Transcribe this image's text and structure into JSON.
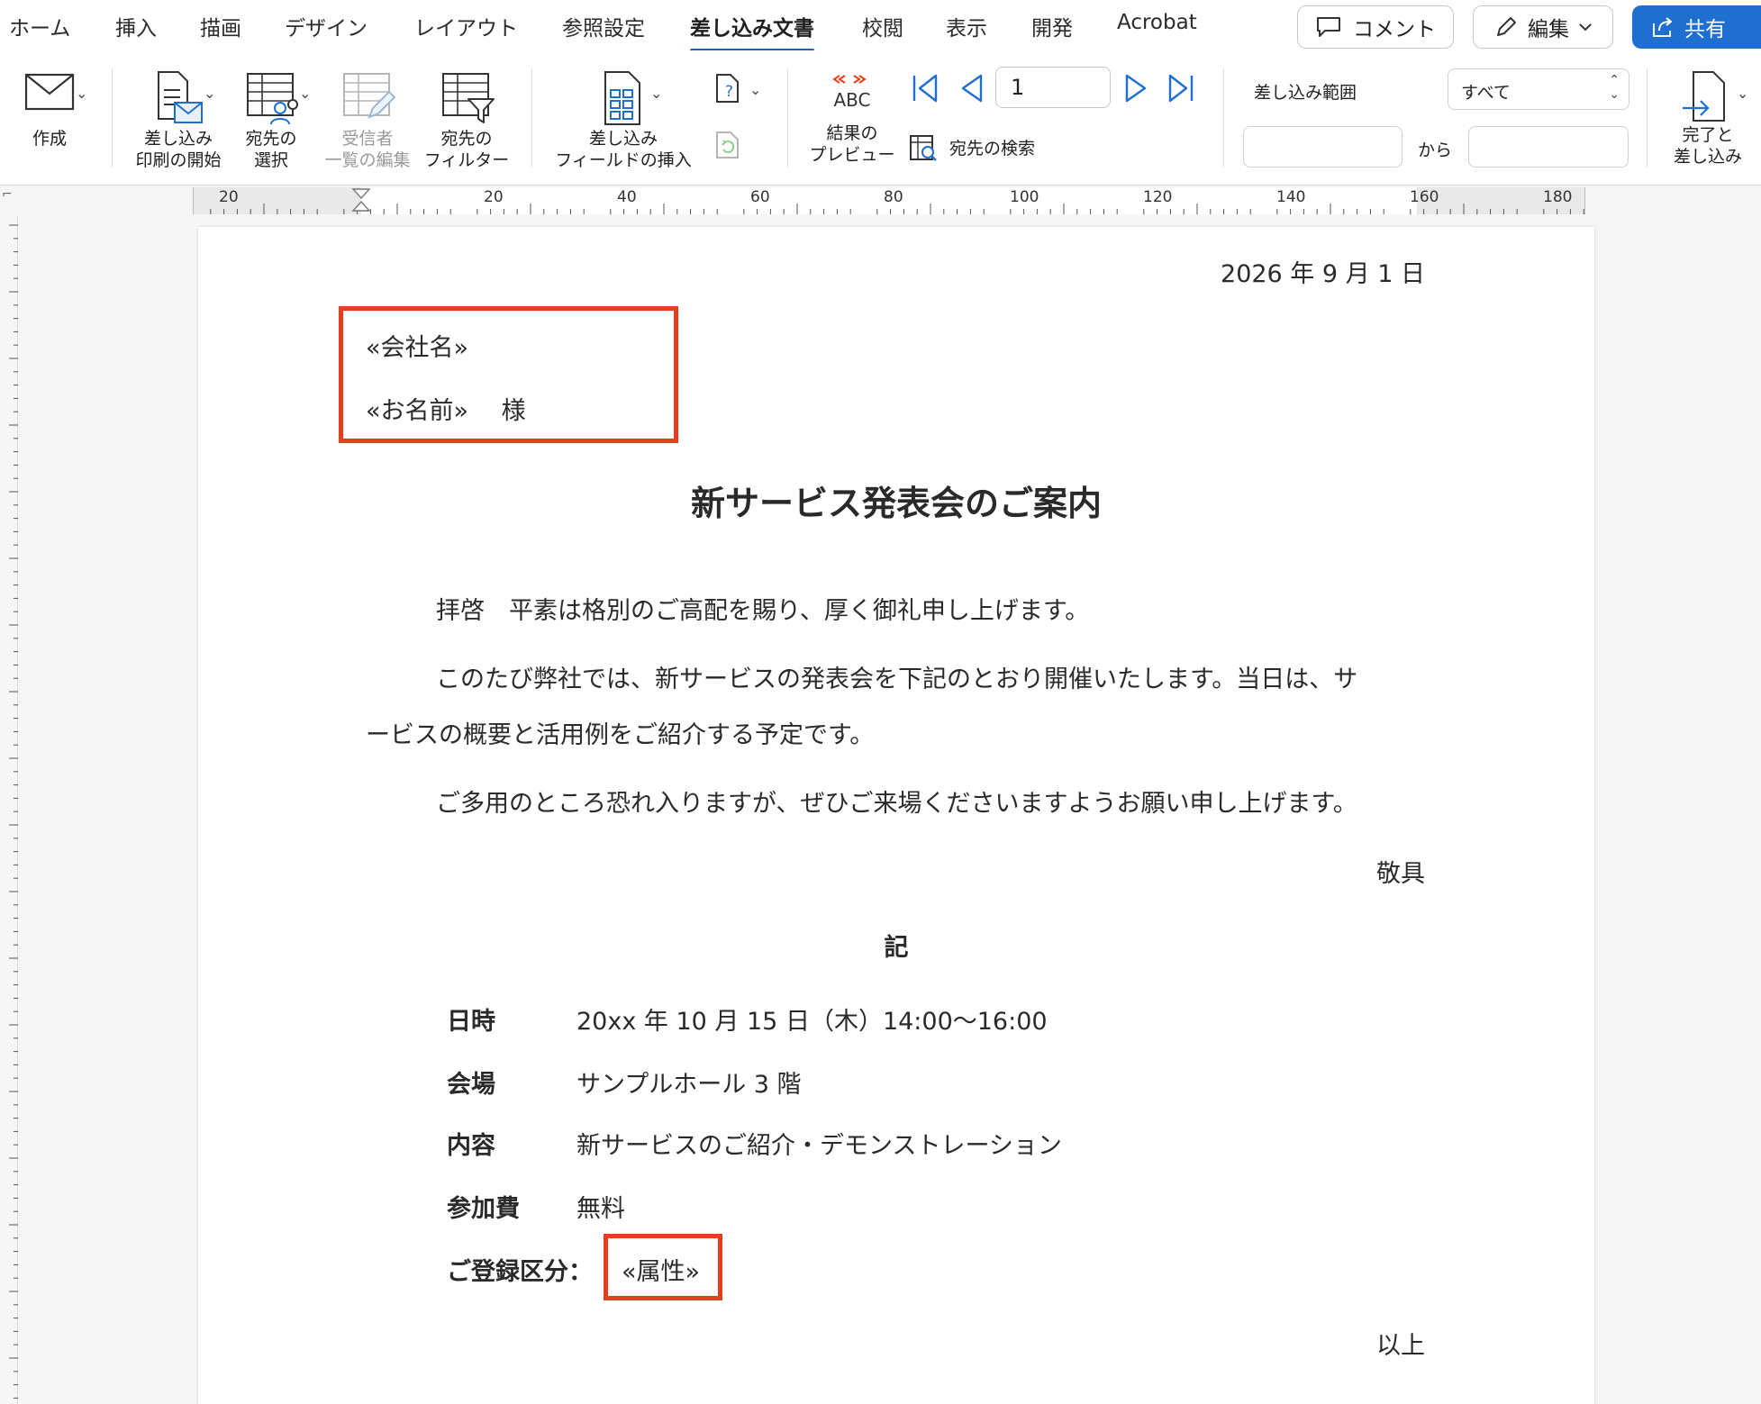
{
  "menu": {
    "tabs": [
      "ホーム",
      "挿入",
      "描画",
      "デザイン",
      "レイアウト",
      "参照設定",
      "差し込み文書",
      "校閲",
      "表示",
      "開発",
      "Acrobat"
    ],
    "active_tab": "差し込み文書",
    "comment_label": "コメント",
    "edit_label": "編集",
    "share_label": "共有"
  },
  "ribbon": {
    "create_label": "作成",
    "start_merge_label1": "差し込み",
    "start_merge_label2": "印刷の開始",
    "select_recipients_label1": "宛先の",
    "select_recipients_label2": "選択",
    "edit_list_label1": "受信者",
    "edit_list_label2": "一覧の編集",
    "filter_label1": "宛先の",
    "filter_label2": "フィルター",
    "insert_field_label1": "差し込み",
    "insert_field_label2": "フィールドの挿入",
    "preview_label1": "結果の",
    "preview_label2": "プレビュー",
    "preview_icon_text": "ABC",
    "find_recipient_label": "宛先の検索",
    "record_number": "1",
    "merge_range_label": "差し込み範囲",
    "merge_range_value": "すべて",
    "from_label": "から",
    "finish_label1": "完了と",
    "finish_label2": "差し込み"
  },
  "ruler": {
    "numbers": [
      "20",
      "20",
      "40",
      "60",
      "80",
      "100",
      "120",
      "140",
      "160",
      "180"
    ]
  },
  "document": {
    "date": "2026 年 9 月 1 日",
    "company_field": "«会社名»",
    "name_field": "«お名前»",
    "honorific": "様",
    "title": "新サービス発表会のご案内",
    "para1": "拝啓　平素は格別のご高配を賜り、厚く御礼申し上げます。",
    "para2_line1": "このたび弊社では、新サービスの発表会を下記のとおり開催いたします。当日は、サ",
    "para2_line2": "ービスの概要と活用例をご紹介する予定です。",
    "para3": "ご多用のところ恐れ入りますが、ぜひご来場くださいますようお願い申し上げます。",
    "closing": "敬具",
    "ki": "記",
    "details": [
      {
        "label": "日時",
        "value": "20xx 年 10 月 15 日（木）14:00〜16:00"
      },
      {
        "label": "会場",
        "value": "サンプルホール 3 階"
      },
      {
        "label": "内容",
        "value": "新サービスのご紹介・デモンストレーション"
      },
      {
        "label": "参加費",
        "value": "無料"
      }
    ],
    "registration_label": "ご登録区分：",
    "registration_field": "«属性»",
    "end": "以上"
  },
  "colors": {
    "highlight_box": "#e2401c",
    "share_button": "#1f6fd1",
    "active_tab_underline": "#1f5fbf"
  }
}
